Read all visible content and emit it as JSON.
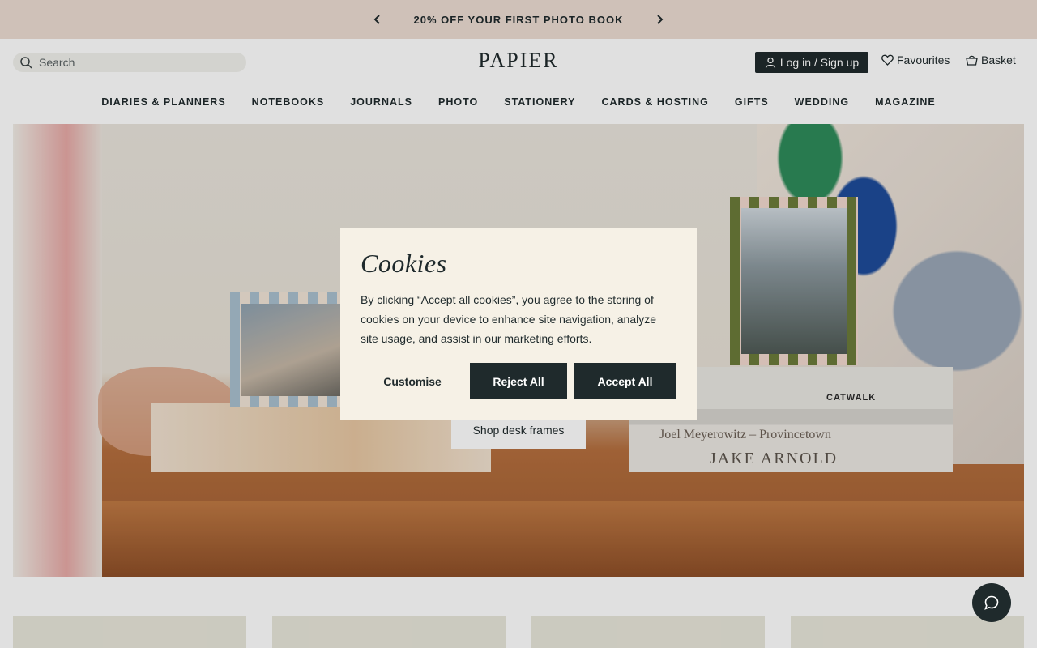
{
  "promo": {
    "text": "20% OFF YOUR FIRST PHOTO BOOK",
    "prev_icon": "chevron-left-icon",
    "next_icon": "chevron-right-icon"
  },
  "header": {
    "search_placeholder": "Search",
    "logo": "PAPIER",
    "login_label": "Log in / Sign up",
    "favourites_label": "Favourites",
    "basket_label": "Basket"
  },
  "nav": {
    "items": [
      "DIARIES & PLANNERS",
      "NOTEBOOKS",
      "JOURNALS",
      "PHOTO",
      "STATIONERY",
      "CARDS & HOSTING",
      "GIFTS",
      "WEDDING",
      "MAGAZINE"
    ]
  },
  "hero": {
    "cta_label": "Shop desk frames",
    "book_titles": [
      "CATWALK",
      "Joel Meyerowitz – Provincetown",
      "JAKE ARNOLD"
    ]
  },
  "cookie_modal": {
    "title": "Cookies",
    "body": "By clicking “Accept all cookies”, you agree to the storing of cookies on your device to enhance site navigation, analyze site usage, and assist in our marketing efforts.",
    "customise_label": "Customise",
    "reject_label": "Reject All",
    "accept_label": "Accept All"
  },
  "colors": {
    "promo_bg": "#ecdcd2",
    "dark": "#1f2a2c",
    "modal_bg": "#f6f1e6"
  }
}
